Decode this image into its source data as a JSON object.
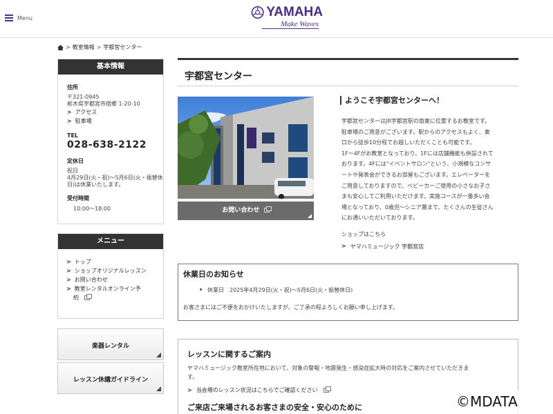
{
  "header": {
    "menu_label": "Menu",
    "brand": "YAMAHA",
    "tagline": "Make Waves",
    "brand_color": "#4b2a85"
  },
  "breadcrumb": {
    "items": [
      "教室情報",
      "宇都宮センター"
    ],
    "separator": ">"
  },
  "sidebar": {
    "info": {
      "heading": "基本情報",
      "address_label": "住所",
      "postal": "〒321-0945",
      "address": "栃木県宇都宮市宿郷 1-20-10",
      "links": [
        "アクセス",
        "駐車場"
      ],
      "tel_label": "TEL",
      "tel": "028-638-2122",
      "closed_label": "定休日",
      "closed_lines": [
        "祝日",
        "4月29日(火・祝)〜5月6日(火・振替休",
        "日)は休業いたします。"
      ],
      "hours_label": "受付時間",
      "hours": "10:00〜18:00"
    },
    "menu": {
      "heading": "メニュー",
      "items": [
        "トップ",
        "ショップオリジナルレッスン",
        "お問い合わせ",
        "教室レンタルオンライン予",
        "約"
      ]
    },
    "buttons": [
      "楽器レンタル",
      "レッスン休講ガイドライン"
    ]
  },
  "main": {
    "title": "宇都宮センター",
    "contact_button": "お問い合わせ",
    "welcome_title": "ようこそ宇都宮センターへ！",
    "welcome_lines": [
      "宇都宮センターはJR宇都宮駅の南東に位置するお教室です。",
      "駐車場のご用意がございます。駅からのアクセスもよく、東",
      "口から徒歩10分程でお越しいただくことも可能です。",
      "1F〜4Fがお教室となっており、1Fには店舗機能も併設されて",
      "おります。4Fには\"イベントサロン\"という、小規模なコンサ",
      "ートや発表会ができるお部屋もございます。エレベーターを",
      "ご用意しておりますので、ベビーカーご使用の小さなお子さ",
      "まも安心してご利用いただけます。実施コースが一番多い会",
      "場となっており、0歳児〜シニア層まで、たくさんの生徒さん",
      "にお通いいただいております。"
    ],
    "shop_label": "ショップはこちら",
    "shop_link": "ヤマハミュージック 宇都宮店",
    "notice": {
      "title": "休業日のお知らせ",
      "item": "休業日　2025年4月29日(火・祝)〜5月6日(火・振替休日)",
      "footer": "お客さまにはご不便をおかけいたしますが、ご了承の程よろしくお願い申し上げます。"
    },
    "lesson": {
      "title": "レッスンに関するご案内",
      "text_lines": [
        "ヤマハミュージック教室所在地において、対象の警報・地震発生・感染症拡大時の対応をご案内させていただきま",
        "す。"
      ],
      "link": "当会場のレッスン状況はこちらでご確認ください",
      "subtitle": "ご来店ご来場されるお客さまの安全・安心のために"
    }
  },
  "watermark": "©MDATA"
}
